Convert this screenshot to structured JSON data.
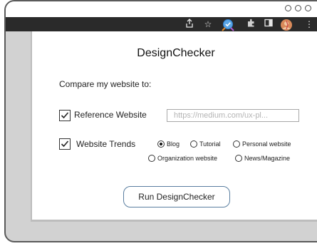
{
  "browser": {
    "toolbar_icons": [
      "share-icon",
      "star-icon",
      "extension-active-icon",
      "puzzle-icon",
      "sidebar-icon",
      "profile-icon",
      "kebab-menu-icon"
    ],
    "accent": "#2a2a2a"
  },
  "popup": {
    "title": "DesignChecker",
    "subtitle": "Compare my website to:",
    "reference": {
      "checked": true,
      "label": "Reference Website",
      "value": "https://medium.com/ux-pl..."
    },
    "trends": {
      "checked": true,
      "label": "Website Trends",
      "options": [
        {
          "label": "Blog",
          "selected": true
        },
        {
          "label": "Tutorial",
          "selected": false
        },
        {
          "label": "Personal website",
          "selected": false
        },
        {
          "label": "Organization website",
          "selected": false
        },
        {
          "label": "News/Magazine",
          "selected": false
        }
      ]
    },
    "run_label": "Run DesignChecker"
  }
}
